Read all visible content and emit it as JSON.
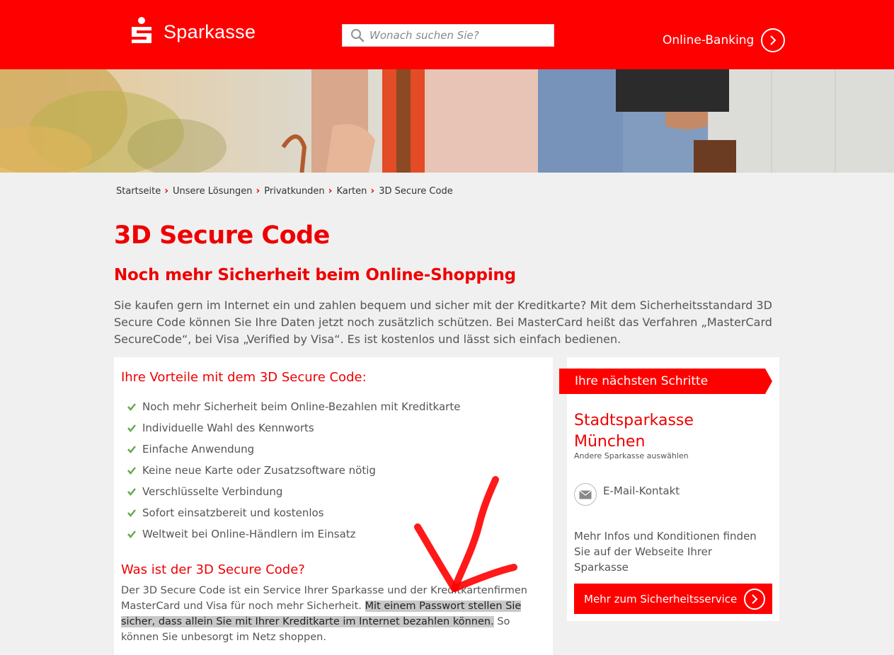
{
  "header": {
    "brand": "Sparkasse",
    "search_placeholder": "Wonach suchen Sie?",
    "online_banking": "Online-Banking",
    "brand_color": "#ff0000"
  },
  "breadcrumb": [
    "Startseite",
    "Unsere Lösungen",
    "Privatkunden",
    "Karten",
    "3D Secure Code"
  ],
  "page": {
    "title": "3D Secure Code",
    "subtitle": "Noch mehr Sicherheit beim Online-Shopping",
    "intro": "Sie kaufen gern im Internet ein und zahlen bequem und sicher mit der Kreditkarte? Mit dem Sicherheitsstandard 3D Secure Code können Sie Ihre Daten jetzt noch zusätzlich schützen. Bei MasterCard heißt das Verfahren  „MasterCard SecureCode“, bei Visa „Verified by Visa“.  Es ist kostenlos und lässt sich einfach bedienen."
  },
  "benefits": {
    "heading": "Ihre Vorteile mit dem 3D Secure Code:",
    "items": [
      "Noch mehr Sicherheit beim Online-Bezahlen mit Kreditkarte",
      "Individuelle Wahl des Kennworts",
      "Einfache Anwendung",
      "Keine neue Karte oder Zusatzsoftware nötig",
      "Verschlüsselte Verbindung",
      "Sofort einsatzbereit und kostenlos",
      "Weltweit bei Online-Händlern im Einsatz"
    ]
  },
  "what": {
    "heading": "Was ist der 3D Secure Code?",
    "text_before": "Der 3D Secure Code ist ein Service Ihrer Sparkasse und der Kreditkartenfirmen MasterCard und Visa für noch mehr Sicherheit. ",
    "text_highlight": "Mit einem Passwort stellen Sie sicher, dass allein Sie mit Ihrer Kreditkarte im Internet bezahlen können.",
    "text_after": " So können Sie unbesorgt im Netz shoppen."
  },
  "sidebar": {
    "ribbon": "Ihre nächsten Schritte",
    "bank_name": "Stadtsparkasse München",
    "change_link": "Andere Sparkasse auswählen",
    "email_contact": "E-Mail-Kontakt",
    "info_text": "Mehr Infos und Konditionen finden Sie auf der Webseite Ihrer Sparkasse",
    "cta": "Mehr zum Sicherheitsservice"
  },
  "icons": {
    "search": "search-icon",
    "online_banking": "chevron-right-circle-icon",
    "check": "check-icon",
    "mail": "mail-icon",
    "cta": "chevron-right-circle-icon"
  }
}
